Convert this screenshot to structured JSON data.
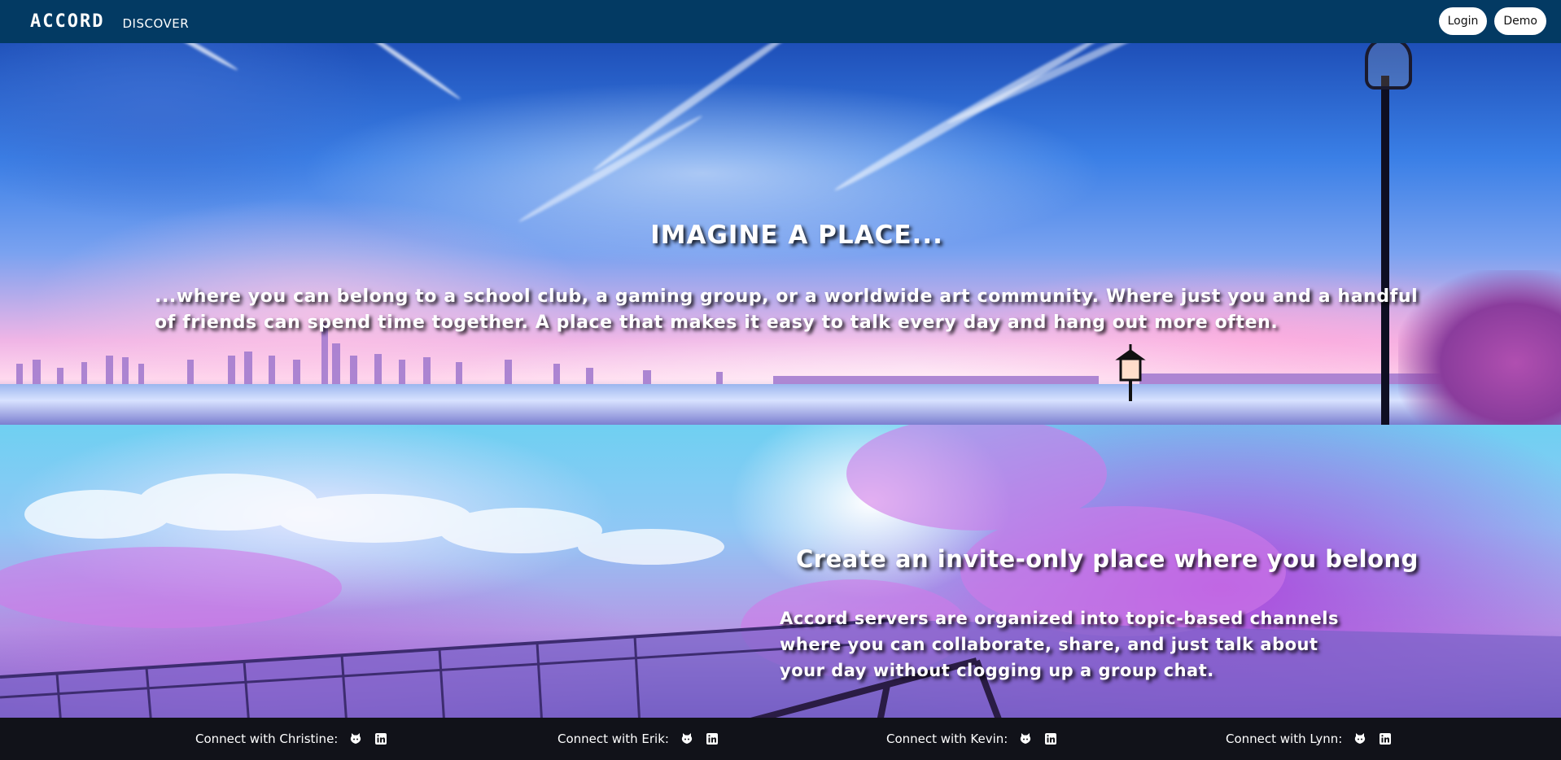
{
  "navbar": {
    "logo": "ACCORD",
    "discover_label": "DISCOVER",
    "login_label": "Login",
    "demo_label": "Demo"
  },
  "hero": {
    "title": "IMAGINE A PLACE...",
    "text": "...where you can belong to a school club, a gaming group, or a worldwide art community. Where just you and a handful of friends can spend time together. A place that makes it easy to talk every day and hang out more often."
  },
  "feature": {
    "title": "Create an invite-only place where you belong",
    "text": "Accord servers are organized into topic-based channels where you can collaborate, share, and just talk about your day without clogging up a group chat."
  },
  "footer": {
    "connections": [
      {
        "label": "Connect with Christine:",
        "icons": [
          "github-icon",
          "linkedin-icon"
        ]
      },
      {
        "label": "Connect with Erik:",
        "icons": [
          "github-icon",
          "linkedin-icon"
        ]
      },
      {
        "label": "Connect with Kevin:",
        "icons": [
          "github-icon",
          "linkedin-icon"
        ]
      },
      {
        "label": "Connect with Lynn:",
        "icons": [
          "github-icon",
          "linkedin-icon"
        ]
      }
    ]
  },
  "colors": {
    "navbar": "#033a63",
    "footer": "#121216",
    "text": "#ffffff"
  }
}
